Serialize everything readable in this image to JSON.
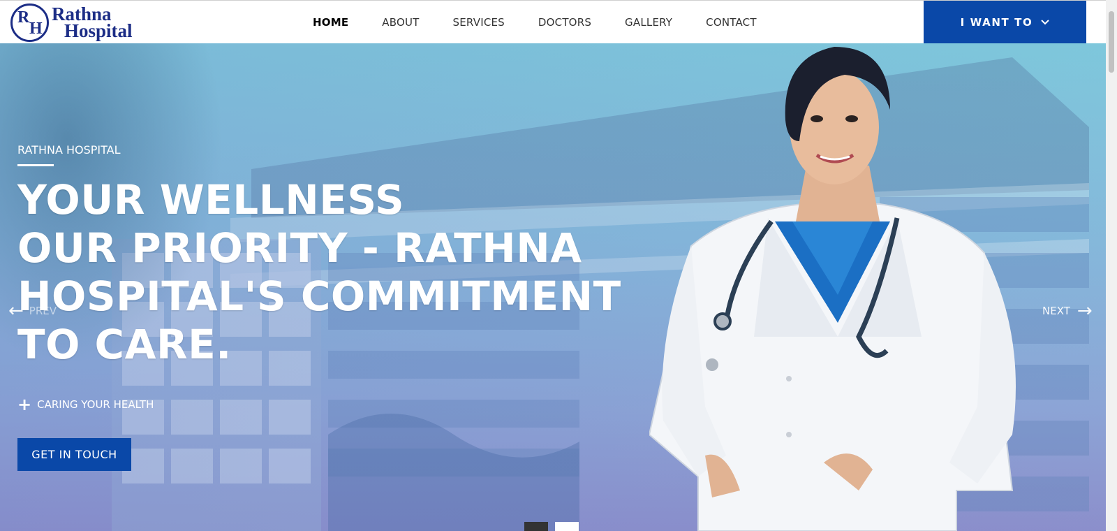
{
  "brand": {
    "monogram_1": "R",
    "monogram_2": "H",
    "name_line1": "Rathna",
    "name_line2": "Hospital",
    "color": "#1c2d86"
  },
  "nav": {
    "items": [
      {
        "label": "HOME",
        "active": true
      },
      {
        "label": "ABOUT"
      },
      {
        "label": "SERVICES"
      },
      {
        "label": "DOCTORS"
      },
      {
        "label": "GALLERY"
      },
      {
        "label": "CONTACT"
      }
    ]
  },
  "want_button": {
    "label": "I WANT TO",
    "icon": "chevron-down-icon",
    "color": "#0a48a8"
  },
  "hero": {
    "kicker": "RATHNA HOSPITAL",
    "title_lines": [
      "YOUR WELLNESS",
      "OUR PRIORITY - RATHNA",
      "HOSPITAL'S COMMITMENT",
      "TO CARE."
    ],
    "tagline": "CARING YOUR HEALTH",
    "tagline_icon": "plus-icon",
    "cta_label": "GET IN TOUCH",
    "prev_label": "PREV",
    "next_label": "NEXT",
    "slides": {
      "count": 2,
      "active": 1
    }
  }
}
